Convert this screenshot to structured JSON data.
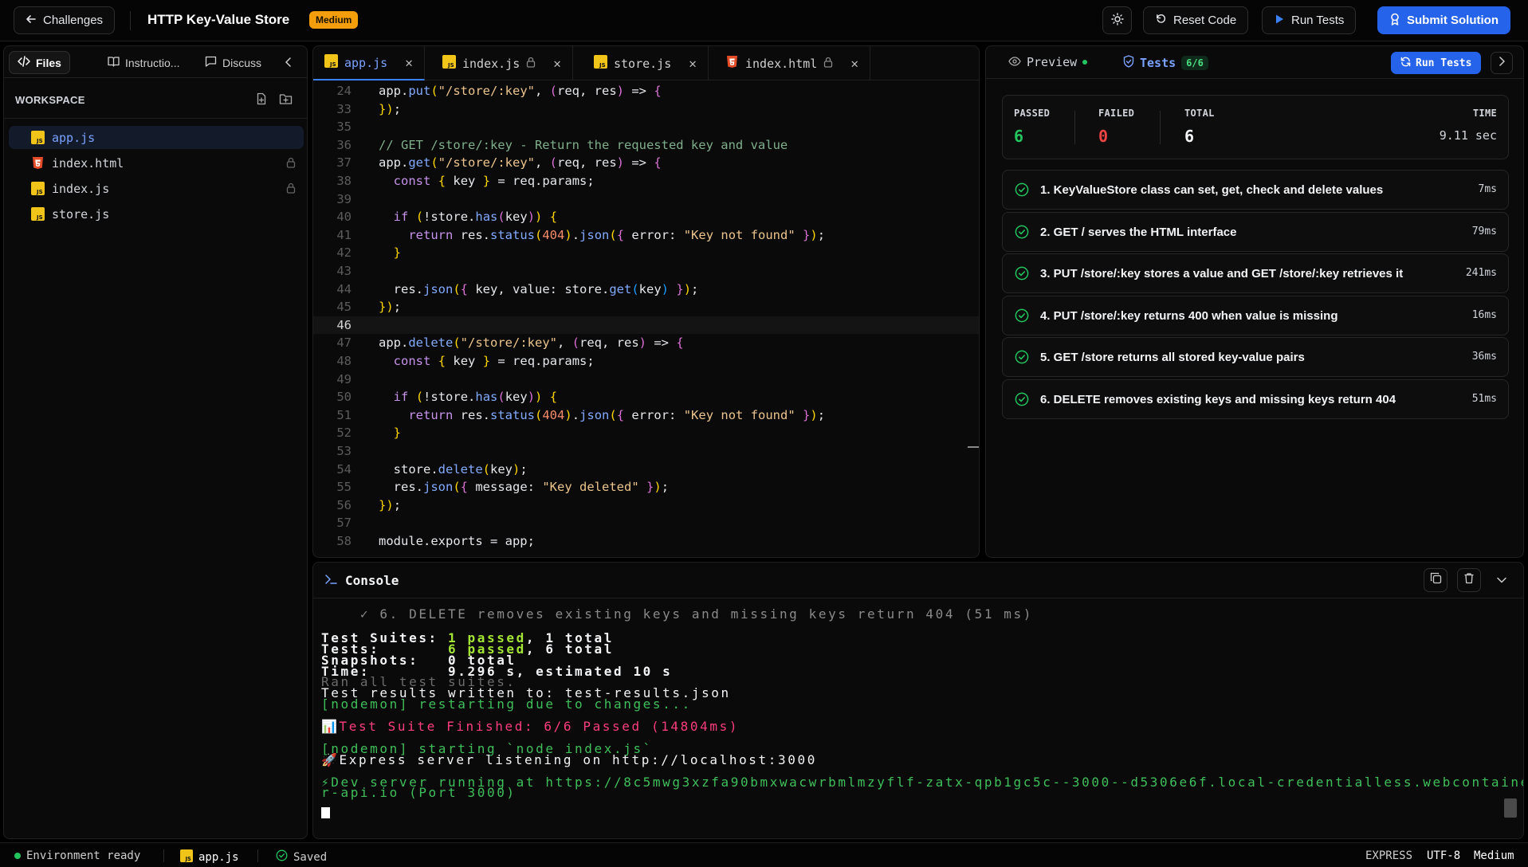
{
  "topbar": {
    "back_label": "Challenges",
    "title": "HTTP Key-Value Store",
    "difficulty": "Medium",
    "reset_label": "Reset Code",
    "run_label": "Run Tests",
    "submit_label": "Submit Solution"
  },
  "left_panel": {
    "tabs": [
      {
        "label": "Files",
        "icon": "code-icon"
      },
      {
        "label": "Instructio...",
        "icon": "book-icon"
      },
      {
        "label": "Discuss",
        "icon": "chat-icon"
      }
    ],
    "workspace_label": "WORKSPACE",
    "files": [
      {
        "name": "app.js",
        "type": "js",
        "locked": false,
        "active": true
      },
      {
        "name": "index.html",
        "type": "html",
        "locked": true,
        "active": false
      },
      {
        "name": "index.js",
        "type": "js",
        "locked": true,
        "active": false
      },
      {
        "name": "store.js",
        "type": "js",
        "locked": false,
        "active": false
      }
    ]
  },
  "editor": {
    "tabs": [
      {
        "name": "app.js",
        "type": "js",
        "locked": false,
        "active": true
      },
      {
        "name": "index.js",
        "type": "js",
        "locked": true,
        "active": false
      },
      {
        "name": "store.js",
        "type": "js",
        "locked": false,
        "active": false
      },
      {
        "name": "index.html",
        "type": "html",
        "locked": true,
        "active": false
      }
    ],
    "current_line": 46,
    "lines": [
      {
        "n": 24,
        "code": "app.put(\"/store/:key\", (req, res) => {"
      },
      {
        "n": 33,
        "code": "});"
      },
      {
        "n": 35,
        "code": ""
      },
      {
        "n": 36,
        "code": "// GET /store/:key - Return the requested key and value"
      },
      {
        "n": 37,
        "code": "app.get(\"/store/:key\", (req, res) => {"
      },
      {
        "n": 38,
        "code": "  const { key } = req.params;"
      },
      {
        "n": 39,
        "code": ""
      },
      {
        "n": 40,
        "code": "  if (!store.has(key)) {"
      },
      {
        "n": 41,
        "code": "    return res.status(404).json({ error: \"Key not found\" });"
      },
      {
        "n": 42,
        "code": "  }"
      },
      {
        "n": 43,
        "code": ""
      },
      {
        "n": 44,
        "code": "  res.json({ key, value: store.get(key) });"
      },
      {
        "n": 45,
        "code": "});"
      },
      {
        "n": 46,
        "code": ""
      },
      {
        "n": 47,
        "code": "app.delete(\"/store/:key\", (req, res) => {"
      },
      {
        "n": 48,
        "code": "  const { key } = req.params;"
      },
      {
        "n": 49,
        "code": ""
      },
      {
        "n": 50,
        "code": "  if (!store.has(key)) {"
      },
      {
        "n": 51,
        "code": "    return res.status(404).json({ error: \"Key not found\" });"
      },
      {
        "n": 52,
        "code": "  }"
      },
      {
        "n": 53,
        "code": ""
      },
      {
        "n": 54,
        "code": "  store.delete(key);"
      },
      {
        "n": 55,
        "code": "  res.json({ message: \"Key deleted\" });"
      },
      {
        "n": 56,
        "code": "});"
      },
      {
        "n": 57,
        "code": ""
      },
      {
        "n": 58,
        "code": "module.exports = app;"
      }
    ]
  },
  "right_panel": {
    "preview_label": "Preview",
    "tests_label": "Tests",
    "tests_count": "6/6",
    "run_label": "Run Tests",
    "summary": {
      "passed_label": "PASSED",
      "passed": "6",
      "failed_label": "FAILED",
      "failed": "0",
      "total_label": "TOTAL",
      "total": "6",
      "time_label": "TIME",
      "time": "9.11 sec"
    },
    "tests": [
      {
        "name": "1. KeyValueStore class can set, get, check and delete values",
        "time": "7ms"
      },
      {
        "name": "2. GET / serves the HTML interface",
        "time": "79ms"
      },
      {
        "name": "3. PUT /store/:key stores a value and GET /store/:key retrieves it",
        "time": "241ms"
      },
      {
        "name": "4. PUT /store/:key returns 400 when value is missing",
        "time": "16ms"
      },
      {
        "name": "5. GET /store returns all stored key-value pairs",
        "time": "36ms"
      },
      {
        "name": "6. DELETE removes existing keys and missing keys return 404",
        "time": "51ms"
      }
    ]
  },
  "console": {
    "title": "Console",
    "lines": [
      {
        "text": "    ✓ 6. DELETE removes existing keys and missing keys return 404 (51 ms)",
        "color": "#8a8a8a"
      },
      {
        "text": "Test Suites: ",
        "bold": "1 passed",
        "rest": ", 1 total",
        "color": "#f3f4f6"
      },
      {
        "text": "Tests:       ",
        "bold": "6 passed",
        "rest": ", 6 total",
        "color": "#f3f4f6"
      },
      {
        "text": "Snapshots:   0 total",
        "color": "#f3f4f6"
      },
      {
        "text": "Time:        9.296 s, estimated 10 s",
        "color": "#f3f4f6"
      },
      {
        "text": "Ran all test suites.",
        "color": "#6b6b6b"
      },
      {
        "text": "Test results written to: test-results.json",
        "color": "#f3f4f6"
      },
      {
        "text": "[nodemon] restarting due to changes...",
        "color": "#3fbf5a"
      },
      {
        "text": "📊Test Suite Finished: 6/6 Passed (14804ms)",
        "color": "#ff3d7f"
      },
      {
        "text": "[nodemon] starting `node index.js`",
        "color": "#3fbf5a"
      },
      {
        "text": "🚀Express server listening on http://localhost:3000",
        "color": "#f3f4f6"
      },
      {
        "text": "⚡Dev server running at https://8c5mwg3xzfa90bmxwacwrbmlmzyflf-zatx-qpb1gc5c--3000--d5306e6f.local-credentialless.webcontaine",
        "color": "#3fbf5a"
      },
      {
        "text": "r-api.io (Port 3000)",
        "color": "#3fbf5a"
      }
    ]
  },
  "statusbar": {
    "env": "Environment ready",
    "file": "app.js",
    "saved": "Saved",
    "framework": "EXPRESS",
    "encoding": "UTF-8",
    "difficulty": "Medium"
  },
  "colors": {
    "accent": "#2563eb",
    "success": "#22c55e",
    "danger": "#ef4444",
    "warning": "#f59e0b"
  }
}
